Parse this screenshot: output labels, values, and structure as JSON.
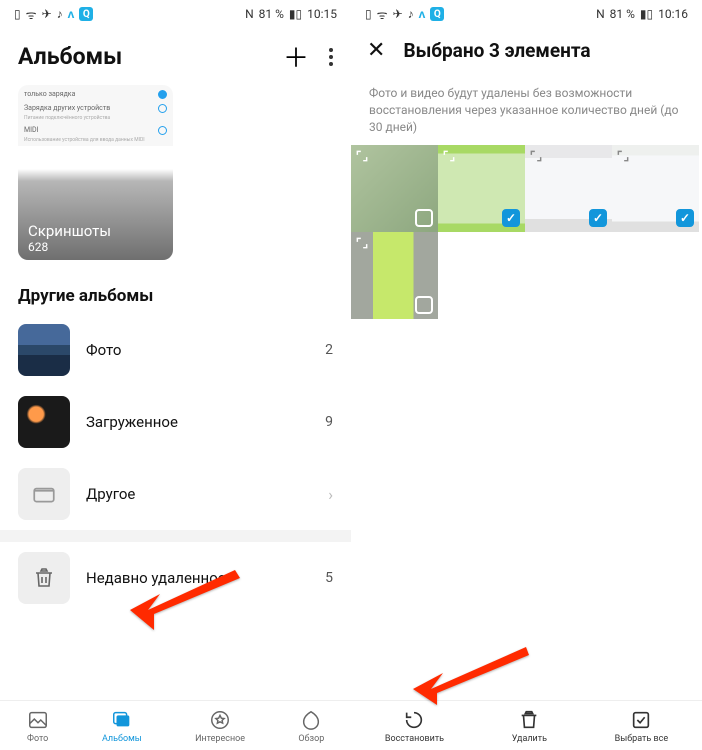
{
  "left": {
    "status": {
      "time": "10:15",
      "battery": "81 %",
      "nfc_label": "N"
    },
    "header": {
      "title": "Альбомы"
    },
    "pinned_card": {
      "row1": "только зарядка",
      "row2": "Зарядка других устройств",
      "row2sub": "Питание подключённого устройства",
      "row3": "MIDI",
      "row3sub": "Использование устройства для ввода данных MIDI",
      "title": "Скриншоты",
      "count": "628"
    },
    "section_other": "Другие альбомы",
    "items": [
      {
        "label": "Фото",
        "count": "2"
      },
      {
        "label": "Загруженное",
        "count": "9"
      },
      {
        "label": "Другое",
        "count": ""
      },
      {
        "label": "Недавно удаленное",
        "count": "5"
      }
    ],
    "bottomnav": [
      {
        "label": "Фото"
      },
      {
        "label": "Альбомы"
      },
      {
        "label": "Интересное"
      },
      {
        "label": "Обзор"
      }
    ]
  },
  "right": {
    "status": {
      "time": "10:16",
      "battery": "81 %",
      "nfc_label": "N"
    },
    "header": {
      "title": "Выбрано 3 элемента"
    },
    "notice": "Фото и видео будут удалены без возможности восстановления через указанное количество дней (до 30 дней)",
    "cells": [
      {
        "selected": false
      },
      {
        "selected": true
      },
      {
        "selected": true
      },
      {
        "selected": true
      },
      {
        "selected": false
      }
    ],
    "actionbar": [
      {
        "label": "Восстановить"
      },
      {
        "label": "Удалить"
      },
      {
        "label": "Выбрать все"
      }
    ]
  }
}
